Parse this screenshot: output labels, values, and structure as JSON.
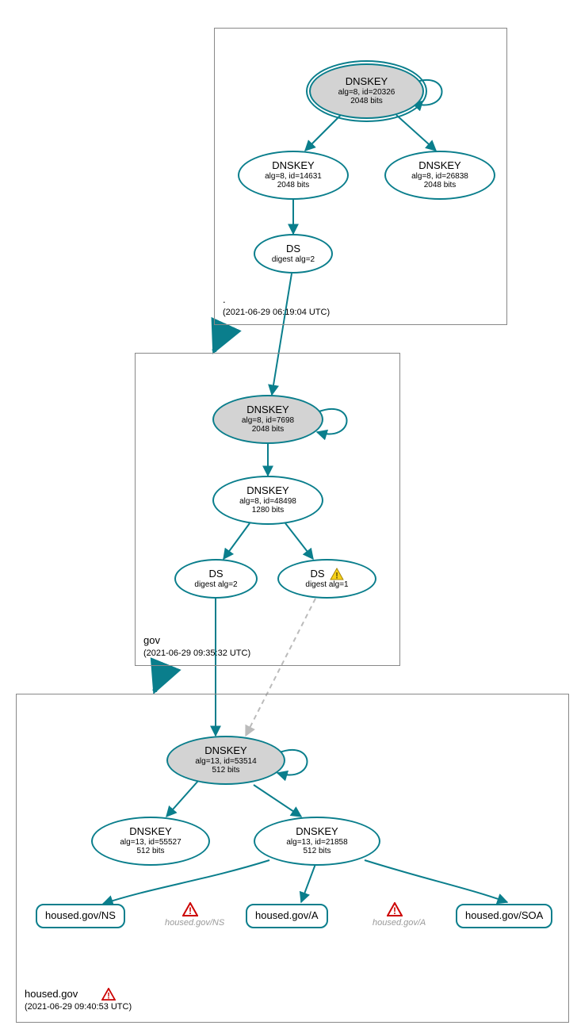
{
  "zones": {
    "root": {
      "name": ".",
      "ts": "(2021-06-29 06:19:04 UTC)"
    },
    "gov": {
      "name": "gov",
      "ts": "(2021-06-29 09:35:32 UTC)"
    },
    "housed": {
      "name": "housed.gov",
      "ts": "(2021-06-29 09:40:53 UTC)"
    }
  },
  "nodes": {
    "root_ksk": {
      "title": "DNSKEY",
      "l1": "alg=8, id=20326",
      "l2": "2048 bits"
    },
    "root_zsk1": {
      "title": "DNSKEY",
      "l1": "alg=8, id=14631",
      "l2": "2048 bits"
    },
    "root_zsk2": {
      "title": "DNSKEY",
      "l1": "alg=8, id=26838",
      "l2": "2048 bits"
    },
    "root_ds": {
      "title": "DS",
      "l1": "digest alg=2"
    },
    "gov_ksk": {
      "title": "DNSKEY",
      "l1": "alg=8, id=7698",
      "l2": "2048 bits"
    },
    "gov_zsk": {
      "title": "DNSKEY",
      "l1": "alg=8, id=48498",
      "l2": "1280 bits"
    },
    "gov_ds2": {
      "title": "DS",
      "l1": "digest alg=2"
    },
    "gov_ds1": {
      "title": "DS",
      "l1": "digest alg=1"
    },
    "hd_ksk": {
      "title": "DNSKEY",
      "l1": "alg=13, id=53514",
      "l2": "512 bits"
    },
    "hd_zsk1": {
      "title": "DNSKEY",
      "l1": "alg=13, id=55527",
      "l2": "512 bits"
    },
    "hd_zsk2": {
      "title": "DNSKEY",
      "l1": "alg=13, id=21858",
      "l2": "512 bits"
    },
    "rr_ns": {
      "label": "housed.gov/NS"
    },
    "rr_a": {
      "label": "housed.gov/A"
    },
    "rr_soa": {
      "label": "housed.gov/SOA"
    },
    "ghost_ns": {
      "label": "housed.gov/NS"
    },
    "ghost_a": {
      "label": "housed.gov/A"
    }
  }
}
